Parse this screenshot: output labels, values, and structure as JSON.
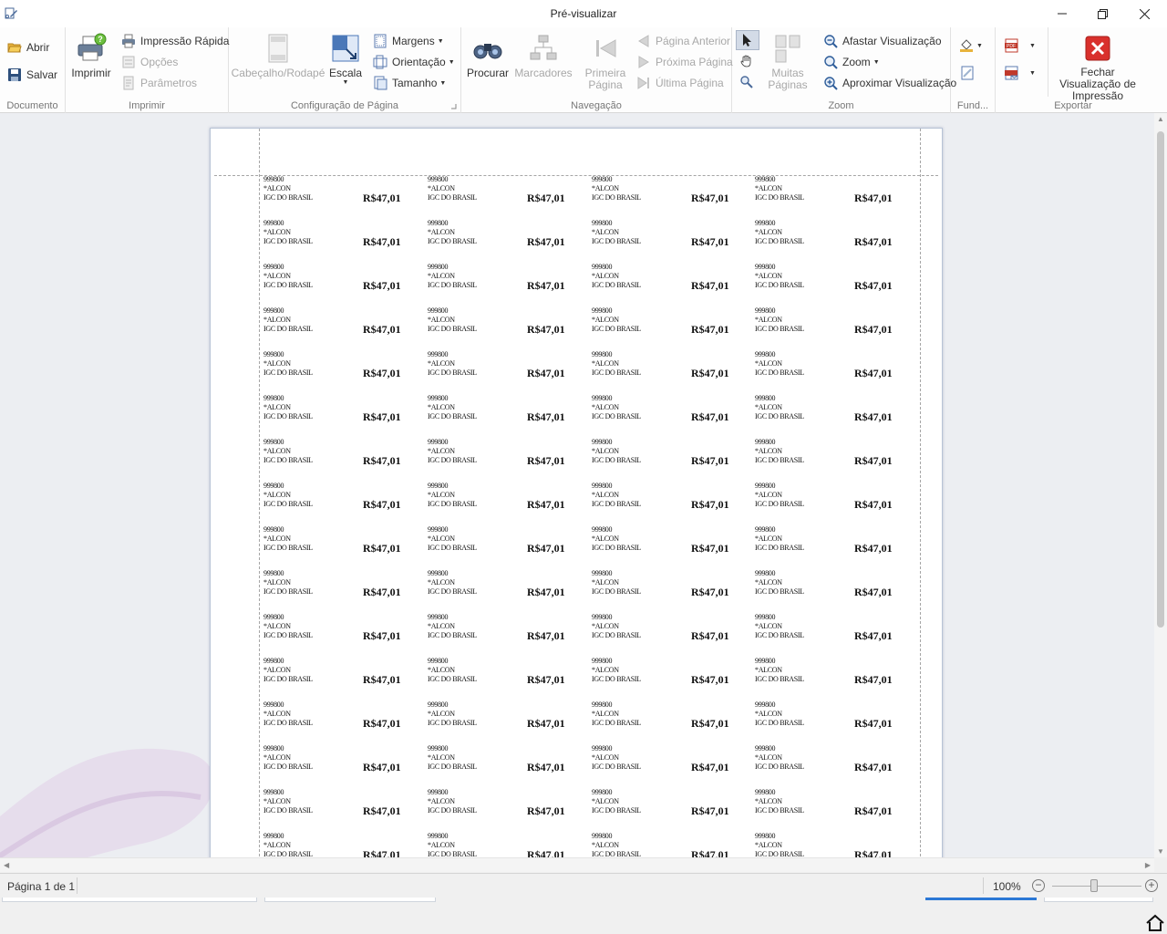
{
  "window": {
    "title": "Pré-visualizar"
  },
  "ribbon": {
    "documento": {
      "caption": "Documento",
      "open": "Abrir",
      "save": "Salvar"
    },
    "imprimir": {
      "caption": "Imprimir",
      "print": "Imprimir",
      "quick_print": "Impressão Rápida",
      "options": "Opções",
      "parameters": "Parâmetros"
    },
    "configuracao": {
      "caption": "Configuração de Página",
      "header_footer": "Cabeçalho/Rodapé",
      "scale": "Escala",
      "margins": "Margens",
      "orientation": "Orientação",
      "size": "Tamanho"
    },
    "navegacao": {
      "caption": "Navegação",
      "search": "Procurar",
      "bookmarks": "Marcadores",
      "first_page": "Primeira Página",
      "previous_page": "Página Anterior",
      "next_page": "Próxima Página",
      "last_page": "Última Página"
    },
    "zoom": {
      "caption": "Zoom",
      "many_pages": "Muitas Páginas",
      "zoom_out": "Afastar Visualização",
      "zoom": "Zoom",
      "zoom_in": "Aproximar Visualização"
    },
    "fundo": {
      "caption": "Fund..."
    },
    "exportar": {
      "caption": "Exportar",
      "close_preview": "Fechar Visualização de Impressão"
    }
  },
  "document": {
    "label": {
      "code": "999800",
      "brand": "*ALCON",
      "company": "IGC DO BRASIL",
      "price": "R$47,01"
    },
    "rows": 16,
    "columns": 4
  },
  "status": {
    "page_info": "Página 1 de 1",
    "zoom_level": "100%",
    "zoom_out": "−",
    "zoom_in": "+"
  },
  "colors": {
    "accent_blue": "#2b78d6",
    "close_red": "#d9302c",
    "page_border": "#b8c3d6"
  }
}
